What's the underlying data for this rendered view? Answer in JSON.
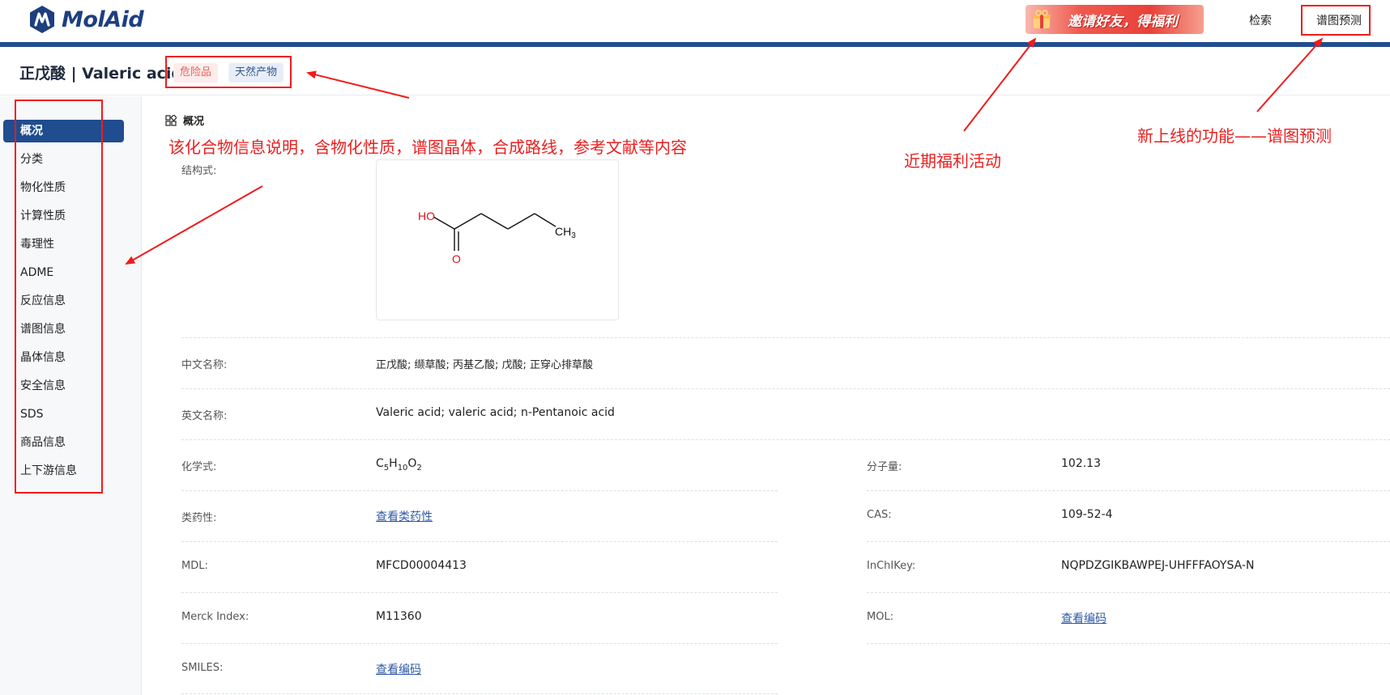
{
  "header": {
    "logo_text": "MolAid",
    "promo_text": "邀请好友，得福利",
    "nav": {
      "search": "检索",
      "spectrum_predict": "谱图预测"
    }
  },
  "compound": {
    "title": "正戊酸 | Valeric acid",
    "tags": [
      "危险品",
      "天然产物"
    ]
  },
  "sidebar": {
    "items": [
      "概况",
      "分类",
      "物化性质",
      "计算性质",
      "毒理性",
      "ADME",
      "反应信息",
      "谱图信息",
      "晶体信息",
      "安全信息",
      "SDS",
      "商品信息",
      "上下游信息"
    ],
    "active_index": 0
  },
  "overview": {
    "section_title": "概况",
    "structure_label": "结构式:",
    "structure_atoms": {
      "hydroxyl": "HO",
      "carbonyl": "O",
      "methyl": "CH",
      "methyl_sub": "3"
    },
    "chinese_name_label": "中文名称:",
    "chinese_name": "正戊酸; 缬草酸; 丙基乙酸; 戊酸; 正穿心排草酸",
    "english_name_label": "英文名称:",
    "english_name": "Valeric acid; valeric acid; n-Pentanoic acid",
    "formula_label": "化学式:",
    "formula": {
      "c": "C",
      "c_sub": "5",
      "h": "H",
      "h_sub": "10",
      "o": "O",
      "o_sub": "2"
    },
    "mw_label": "分子量:",
    "mw": "102.13",
    "druglike_label": "类药性:",
    "druglike_link": "查看类药性",
    "cas_label": "CAS:",
    "cas": "109-52-4",
    "mdl_label": "MDL:",
    "mdl": "MFCD00004413",
    "inchikey_label": "InChIKey:",
    "inchikey": "NQPDZGIKBAWPEJ-UHFFFAOYSA-N",
    "merck_label": "Merck Index:",
    "merck": "M11360",
    "mol_label": "MOL:",
    "mol_link": "查看编码",
    "smiles_label": "SMILES:",
    "smiles_link": "查看编码"
  },
  "annotations": {
    "overview_note": "该化合物信息说明，含物化性质，谱图晶体，合成路线，参考文献等内容",
    "promo_note": "近期福利活动",
    "feature_note": "新上线的功能——谱图预测"
  },
  "colors": {
    "brand": "#1f4d8f",
    "annotation": "#f11b1b",
    "link": "#2e5aa5"
  }
}
